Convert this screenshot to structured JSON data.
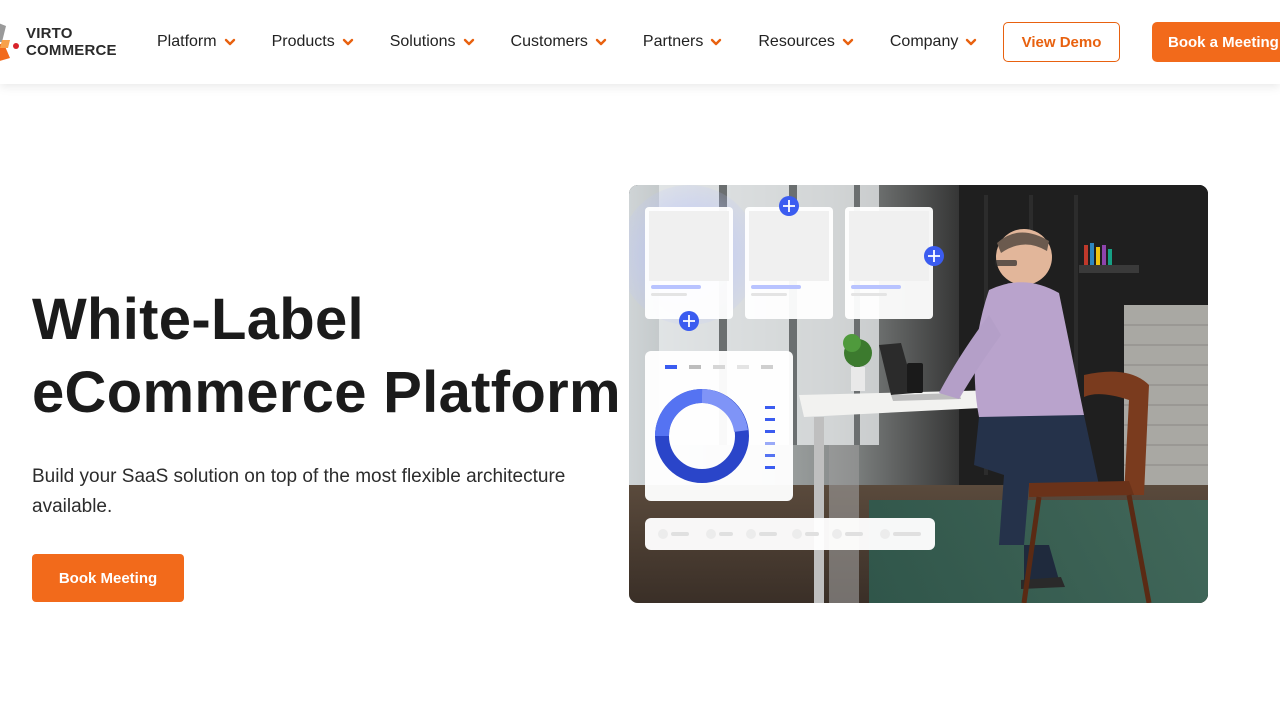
{
  "brand": {
    "line1": "VIRTO",
    "line2": "COMMERCE",
    "accent_color": "#f26a1b"
  },
  "nav": {
    "items": [
      {
        "label": "Platform"
      },
      {
        "label": "Products"
      },
      {
        "label": "Solutions"
      },
      {
        "label": "Customers"
      },
      {
        "label": "Partners"
      },
      {
        "label": "Resources"
      },
      {
        "label": "Company"
      }
    ],
    "view_demo_label": "View Demo",
    "book_meeting_label": "Book a Meeting"
  },
  "hero": {
    "title_line1": "White-Label",
    "title_line2": "eCommerce Platform",
    "subtitle": "Build your SaaS solution on top of the most flexible architecture available.",
    "cta_label": "Book Meeting"
  },
  "icons": {
    "nav_chevron": "chevron-down-icon",
    "plus": "plus-icon",
    "donut": "donut-chart-icon"
  }
}
